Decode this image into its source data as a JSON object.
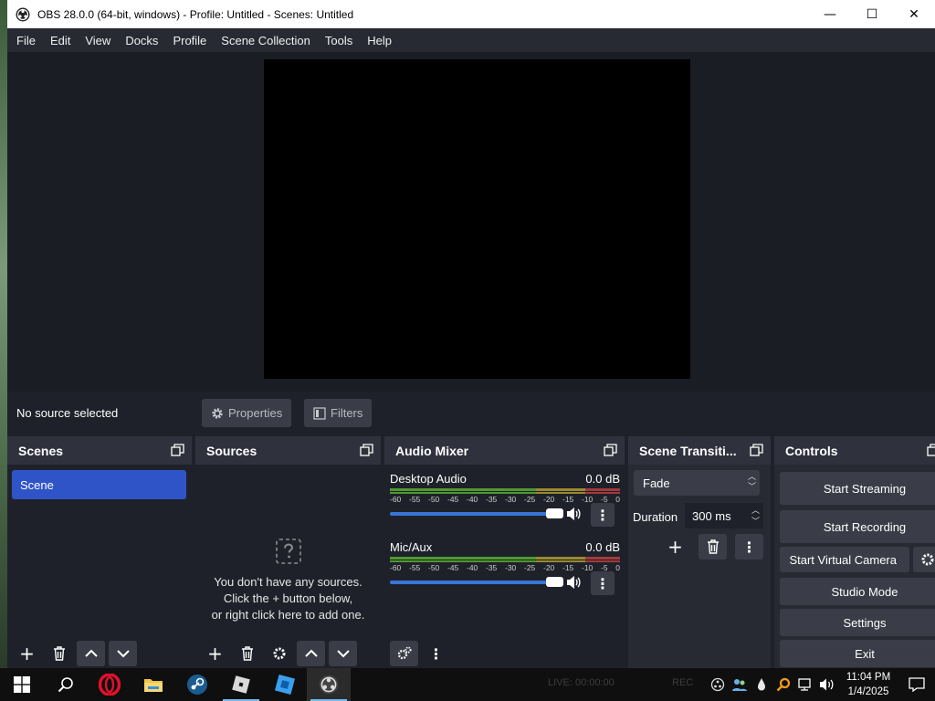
{
  "window": {
    "title": "OBS 28.0.0 (64-bit, windows) - Profile: Untitled - Scenes: Untitled",
    "minimize_glyph": "—",
    "maximize_glyph": "☐",
    "close_glyph": "✕"
  },
  "menu": [
    "File",
    "Edit",
    "View",
    "Docks",
    "Profile",
    "Scene Collection",
    "Tools",
    "Help"
  ],
  "source_bar": {
    "status": "No source selected",
    "properties_label": "Properties",
    "filters_label": "Filters"
  },
  "scenes": {
    "title": "Scenes",
    "items": [
      "Scene"
    ]
  },
  "sources": {
    "title": "Sources",
    "empty_lines": [
      "You don't have any sources.",
      "Click the + button below,",
      "or right click here to add one."
    ]
  },
  "mixer": {
    "title": "Audio Mixer",
    "ticks": [
      "-60",
      "-55",
      "-50",
      "-45",
      "-40",
      "-35",
      "-30",
      "-25",
      "-20",
      "-15",
      "-10",
      "-5",
      "0"
    ],
    "channels": [
      {
        "name": "Desktop Audio",
        "db": "0.0 dB",
        "volume": 1.0
      },
      {
        "name": "Mic/Aux",
        "db": "0.0 dB",
        "volume": 1.0
      }
    ]
  },
  "transitions": {
    "title": "Scene Transiti...",
    "selected": "Fade",
    "duration_label": "Duration",
    "duration_value": "300 ms"
  },
  "controls": {
    "title": "Controls",
    "start_streaming": "Start Streaming",
    "start_recording": "Start Recording",
    "start_virtual_camera": "Start Virtual Camera",
    "studio_mode": "Studio Mode",
    "settings": "Settings",
    "exit": "Exit"
  },
  "taskbar": {
    "status_ghost": "LIVE: 00:00:00",
    "rec_ghost": "REC",
    "time": "11:04 PM",
    "date": "1/4/2025"
  },
  "colors": {
    "accent_selection": "#2f54c7",
    "slider": "#3875d7",
    "meter_green": "#4f9a2e",
    "meter_yellow": "#9a8a2e",
    "meter_red": "#a33a3a"
  }
}
